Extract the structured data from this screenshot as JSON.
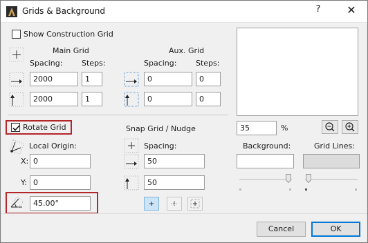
{
  "window": {
    "title": "Grids & Background",
    "help_label": "?",
    "close_label": "✕"
  },
  "construction": {
    "show_grid_label": "Show Construction Grid",
    "show_grid_checked": false,
    "main_grid_header": "Main Grid",
    "aux_grid_header": "Aux. Grid",
    "spacing_label": "Spacing:",
    "steps_label": "Steps:",
    "main_h_spacing": "2000",
    "main_h_steps": "1",
    "main_v_spacing": "2000",
    "main_v_steps": "1",
    "aux_h_spacing": "0",
    "aux_h_steps": "0",
    "aux_v_spacing": "0",
    "aux_v_steps": "0"
  },
  "rotate": {
    "rotate_label": "Rotate Grid",
    "rotate_checked": true,
    "local_origin_label": "Local Origin:",
    "x_label": "X:",
    "x_value": "0",
    "y_label": "Y:",
    "y_value": "0",
    "angle_value": "45.00°"
  },
  "snap": {
    "header": "Snap Grid / Nudge",
    "spacing_label": "Spacing:",
    "h_spacing": "50",
    "v_spacing": "50"
  },
  "preview": {
    "zoom_value": "35",
    "zoom_unit": "%",
    "zoom_out_icon": "zoom-out-icon",
    "zoom_in_icon": "zoom-in-icon"
  },
  "colors": {
    "background_label": "Background:",
    "grid_lines_label": "Grid Lines:",
    "background_color": "#ffffff",
    "grid_lines_color": "#dcdcdc",
    "highlight_color": "#b3262a",
    "accent_color": "#0078d7"
  },
  "footer": {
    "cancel_label": "Cancel",
    "ok_label": "OK"
  }
}
